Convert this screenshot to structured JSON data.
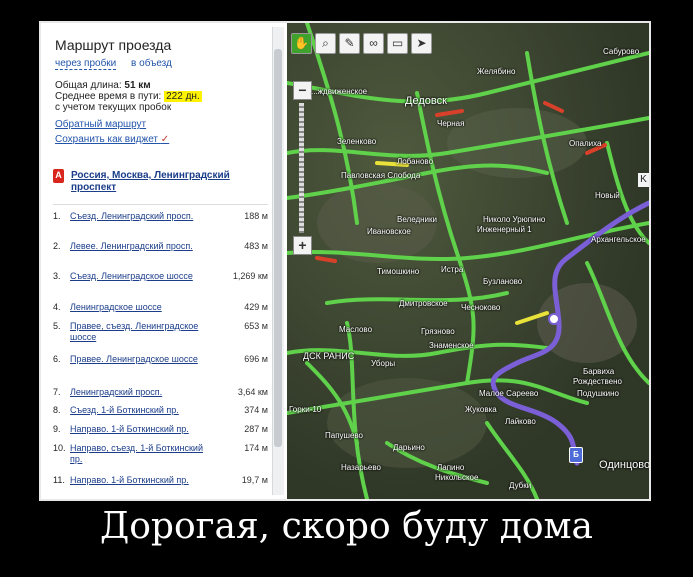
{
  "sidebar": {
    "title": "Маршрут проезда",
    "links": [
      "через пробки",
      "в объезд"
    ],
    "total_length_label": "Общая длина:",
    "total_length_value": "51 км",
    "avg_time_label": "Среднее время в пути:",
    "avg_time_value": "222 дн.",
    "traffic_note": "с учетом текущих пробок",
    "reverse_route": "Обратный маршрут",
    "save_widget": "Сохранить как виджет",
    "start_marker": "A",
    "start_address": "Россия, Москва, Ленинградский проспект",
    "steps": [
      {
        "num": "1.",
        "text": "Съезд. Ленинградский просп.",
        "dist": "188 м"
      },
      {
        "num": "2.",
        "text": "Левее. Ленинградский просп.",
        "dist": "483 м"
      },
      {
        "num": "3.",
        "text": "Съезд. Ленинградское шоссе",
        "dist": "1,269 км"
      },
      {
        "num": "4.",
        "text": "Ленинградское шоссе",
        "dist": "429 м"
      },
      {
        "num": "5.",
        "text": "Правее, съезд. Ленинградское шоссе",
        "dist": "653 м"
      },
      {
        "num": "6.",
        "text": "Правее. Ленинградское шоссе",
        "dist": "696 м"
      },
      {
        "num": "7.",
        "text": "Ленинградский просп.",
        "dist": "3,64 км"
      },
      {
        "num": "8.",
        "text": "Съезд. 1-й Боткинский пр.",
        "dist": "374 м"
      },
      {
        "num": "9.",
        "text": "Направо. 1-й Боткинский пр.",
        "dist": "287 м"
      },
      {
        "num": "10.",
        "text": "Направо, съезд. 1-й Боткинский пр.",
        "dist": "174 м"
      },
      {
        "num": "11.",
        "text": "Направо. 1-й Боткинский пр.",
        "dist": "19,7 м"
      }
    ]
  },
  "map": {
    "toolbar_icons": [
      "hand-icon",
      "magnifier-icon",
      "ruler-icon",
      "link-icon",
      "print-icon",
      "pointer-icon"
    ],
    "zoom_in": "+",
    "zoom_out": "−",
    "end_marker": "Б",
    "edge_marker": "K",
    "labels": {
      "dedovsk": "Дедовск",
      "zhelyabino": "Желябино",
      "sabyrovo": "Сабурово",
      "opalikha": "Опалиха",
      "chernaya": "Черная",
      "zelenkovo": "Зеленково",
      "lobanovo": "Лобаново",
      "pavlovskaya_sloboda": "Павловская Слобода",
      "vozdvizhenskoe": "...ждвиженское",
      "veledniki": "Веледники",
      "ivanovskoe": "Ивановское",
      "nikolo_uryupino": "Николо Урюпино",
      "inzhenerny": "Инженерный 1",
      "novy": "Новый",
      "arkhangelskoe": "Архангельское",
      "timoshkino": "Тимошкино",
      "istra": "Истра",
      "buzlanovo": "Бузланово",
      "dmitrovskoe": "Дмитровское",
      "chesnokovo": "Чесноково",
      "maslovo": "Маслово",
      "gryaznovo": "Грязново",
      "znamenskoe": "Знаменское",
      "dsk_ranis": "ДСК РАНИС",
      "uhory": "Уборы",
      "barvikha": "Барвиха",
      "rozhdestveno": "Рождествено",
      "podushkino": "Подушкино",
      "maloe_saveevo": "Малое Сареево",
      "zhukovka": "Жуковка",
      "laykovo": "Лайково",
      "gorki10": "Горки-10",
      "papushevo": "Папушево",
      "darino": "Дарьино",
      "nazaryevo": "Назарьево",
      "lapino": "Лапино",
      "nikolskoe": "Никольское",
      "dubki": "Дубки",
      "odintsovo": "Одинцово"
    }
  },
  "caption": "Дорогая, скоро буду дома"
}
